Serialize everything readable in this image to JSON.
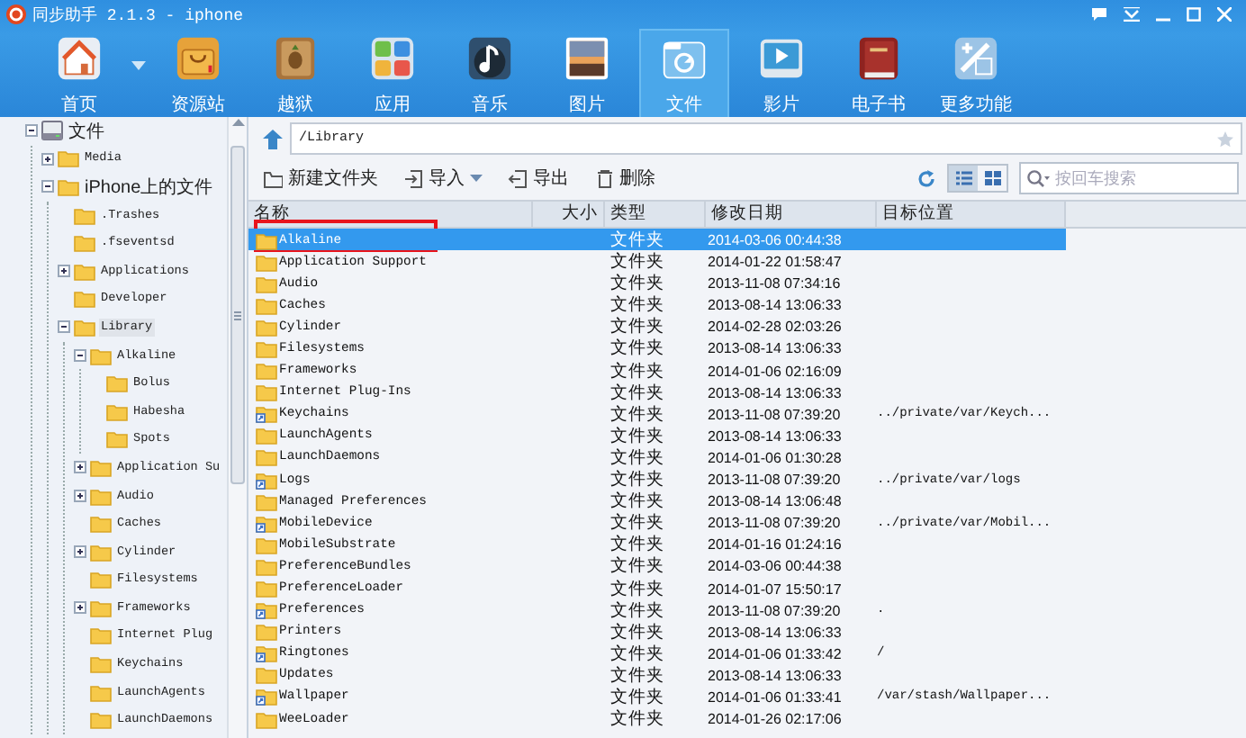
{
  "window": {
    "title": "同步助手 2.1.3 - iphone"
  },
  "toolbar": {
    "items": [
      {
        "label": "首页",
        "selected": false,
        "dropdown": true
      },
      {
        "label": "资源站",
        "selected": false
      },
      {
        "label": "越狱",
        "selected": false
      },
      {
        "label": "应用",
        "selected": false
      },
      {
        "label": "音乐",
        "selected": false
      },
      {
        "label": "图片",
        "selected": false
      },
      {
        "label": "文件",
        "selected": true
      },
      {
        "label": "影片",
        "selected": false
      },
      {
        "label": "电子书",
        "selected": false
      },
      {
        "label": "更多功能",
        "selected": false
      }
    ]
  },
  "tree": [
    {
      "label": "文件",
      "kind": "drive",
      "expanded": true,
      "selected": false,
      "children": [
        {
          "label": "Media",
          "expanded": false,
          "selected": false
        },
        {
          "label": "iPhone上的文件",
          "expanded": true,
          "selected": false,
          "children": [
            {
              "label": ".Trashes",
              "selected": false
            },
            {
              "label": ".fseventsd",
              "selected": false
            },
            {
              "label": "Applications",
              "expanded": false,
              "selected": false
            },
            {
              "label": "Developer",
              "selected": false
            },
            {
              "label": "Library",
              "expanded": true,
              "selected": true,
              "children": [
                {
                  "label": "Alkaline",
                  "expanded": true,
                  "selected": false,
                  "children": [
                    {
                      "label": "Bolus",
                      "selected": false
                    },
                    {
                      "label": "Habesha",
                      "selected": false
                    },
                    {
                      "label": "Spots",
                      "selected": false
                    }
                  ]
                },
                {
                  "label": "Application Su",
                  "expanded": false,
                  "selected": false
                },
                {
                  "label": "Audio",
                  "expanded": false,
                  "selected": false
                },
                {
                  "label": "Caches",
                  "selected": false
                },
                {
                  "label": "Cylinder",
                  "expanded": false,
                  "selected": false
                },
                {
                  "label": "Filesystems",
                  "selected": false
                },
                {
                  "label": "Frameworks",
                  "expanded": false,
                  "selected": false
                },
                {
                  "label": "Internet Plug",
                  "selected": false
                },
                {
                  "label": "Keychains",
                  "selected": false
                },
                {
                  "label": "LaunchAgents",
                  "selected": false
                },
                {
                  "label": "LaunchDaemons",
                  "selected": false
                }
              ]
            }
          ]
        }
      ]
    }
  ],
  "path": {
    "value": "/Library"
  },
  "actions": [
    {
      "label": "新建文件夹"
    },
    {
      "label": "导入",
      "dropdown": true
    },
    {
      "label": "导出"
    },
    {
      "label": "删除"
    }
  ],
  "search": {
    "placeholder": "按回车搜索"
  },
  "view": {
    "list_selected": true
  },
  "table": {
    "columns": [
      "名称",
      "大小",
      "类型",
      "修改日期",
      "目标位置"
    ],
    "rows": [
      {
        "name": "Alkaline",
        "kind": "folder",
        "type": "文件夹",
        "date": "2014-03-06 00:44:38",
        "selected": true,
        "marked": true
      },
      {
        "name": "Application Support",
        "kind": "folder",
        "type": "文件夹",
        "date": "2014-01-22 01:58:47",
        "selected": false,
        "marked": false
      },
      {
        "name": "Audio",
        "kind": "folder",
        "type": "文件夹",
        "date": "2013-11-08 07:34:16",
        "selected": false,
        "marked": false
      },
      {
        "name": "Caches",
        "kind": "folder",
        "type": "文件夹",
        "date": "2013-08-14 13:06:33",
        "selected": false,
        "marked": false
      },
      {
        "name": "Cylinder",
        "kind": "folder",
        "type": "文件夹",
        "date": "2014-02-28 02:03:26",
        "selected": false,
        "marked": false
      },
      {
        "name": "Filesystems",
        "kind": "folder",
        "type": "文件夹",
        "date": "2013-08-14 13:06:33",
        "selected": false,
        "marked": false
      },
      {
        "name": "Frameworks",
        "kind": "folder",
        "type": "文件夹",
        "date": "2014-01-06 02:16:09",
        "selected": false,
        "marked": false
      },
      {
        "name": "Internet Plug-Ins",
        "kind": "folder",
        "type": "文件夹",
        "date": "2013-08-14 13:06:33",
        "selected": false,
        "marked": false
      },
      {
        "name": "Keychains",
        "kind": "link",
        "type": "文件夹",
        "date": "2013-11-08 07:39:20",
        "target": "../private/var/Keych...",
        "selected": false,
        "marked": false
      },
      {
        "name": "LaunchAgents",
        "kind": "folder",
        "type": "文件夹",
        "date": "2013-08-14 13:06:33",
        "selected": false,
        "marked": false
      },
      {
        "name": "LaunchDaemons",
        "kind": "folder",
        "type": "文件夹",
        "date": "2014-01-06 01:30:28",
        "selected": false,
        "marked": false
      },
      {
        "name": "Logs",
        "kind": "link",
        "type": "文件夹",
        "date": "2013-11-08 07:39:20",
        "target": "../private/var/logs",
        "selected": false,
        "marked": false
      },
      {
        "name": "Managed Preferences",
        "kind": "folder",
        "type": "文件夹",
        "date": "2013-08-14 13:06:48",
        "selected": false,
        "marked": false
      },
      {
        "name": "MobileDevice",
        "kind": "link",
        "type": "文件夹",
        "date": "2013-11-08 07:39:20",
        "target": "../private/var/Mobil...",
        "selected": false,
        "marked": false
      },
      {
        "name": "MobileSubstrate",
        "kind": "folder",
        "type": "文件夹",
        "date": "2014-01-16 01:24:16",
        "selected": false,
        "marked": false
      },
      {
        "name": "PreferenceBundles",
        "kind": "folder",
        "type": "文件夹",
        "date": "2014-03-06 00:44:38",
        "selected": false,
        "marked": false
      },
      {
        "name": "PreferenceLoader",
        "kind": "folder",
        "type": "文件夹",
        "date": "2014-01-07 15:50:17",
        "selected": false,
        "marked": false
      },
      {
        "name": "Preferences",
        "kind": "link",
        "type": "文件夹",
        "date": "2013-11-08 07:39:20",
        "target": ".",
        "selected": false,
        "marked": false
      },
      {
        "name": "Printers",
        "kind": "folder",
        "type": "文件夹",
        "date": "2013-08-14 13:06:33",
        "selected": false,
        "marked": false
      },
      {
        "name": "Ringtones",
        "kind": "link",
        "type": "文件夹",
        "date": "2014-01-06 01:33:42",
        "target": "/",
        "selected": false,
        "marked": false
      },
      {
        "name": "Updates",
        "kind": "folder",
        "type": "文件夹",
        "date": "2013-08-14 13:06:33",
        "selected": false,
        "marked": false
      },
      {
        "name": "Wallpaper",
        "kind": "link",
        "type": "文件夹",
        "date": "2014-01-06 01:33:41",
        "target": "/var/stash/Wallpaper...",
        "selected": false,
        "marked": false
      },
      {
        "name": "WeeLoader",
        "kind": "folder",
        "type": "文件夹",
        "date": "2014-01-26 02:17:06",
        "selected": false,
        "marked": false
      }
    ]
  }
}
